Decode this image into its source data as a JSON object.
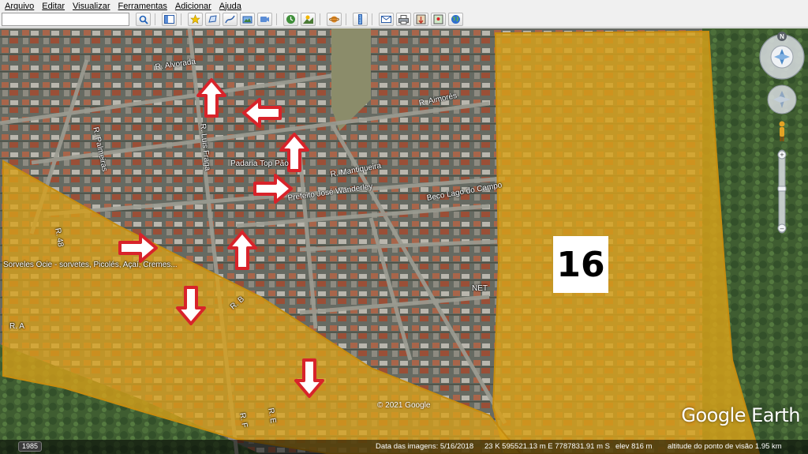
{
  "menu": {
    "items": [
      "Arquivo",
      "Editar",
      "Visualizar",
      "Ferramentas",
      "Adicionar",
      "Ajuda"
    ]
  },
  "search": {
    "value": "",
    "placeholder": ""
  },
  "toolbar": {
    "buttons": [
      "sidebar-icon",
      "placemark-icon",
      "polygon-icon",
      "path-icon",
      "image-overlay-icon",
      "record-tour-icon",
      "historical-imagery-icon",
      "sunlight-icon",
      "planets-icon",
      "ruler-icon",
      "email-icon",
      "print-icon",
      "save-image-icon",
      "view-in-maps-icon",
      "earth-icon"
    ]
  },
  "map": {
    "area_label": "16",
    "streets": [
      "R. Alvorada",
      "R. Aimorés",
      "R. Palmeiras",
      "R. Luis Fraga",
      "Padaria Top Pão",
      "R. Mantiqueira",
      "Prefeito José Wanderley",
      "Beco Lago do Campo",
      "R. 48",
      "R. A",
      "R. B",
      "R. F",
      "R. E",
      "NET",
      "Sorveles Ocie - sorvetes, Picolés, Açaí, Cremes..."
    ],
    "copyright": "© 2021 Google",
    "brand": "Google Earth",
    "overlay_color": "#d9a21a",
    "arrow_color": "#d8232a"
  },
  "navigation": {
    "north_label": "N"
  },
  "status": {
    "year": "1985",
    "imagery_date": "Data das imagens: 5/16/2018",
    "coordinates": "23 K 595521.13 m E 7787831.91 m S",
    "elevation": "elev 816 m",
    "eye_altitude": "altitude do ponto de visão 1.95 km"
  }
}
